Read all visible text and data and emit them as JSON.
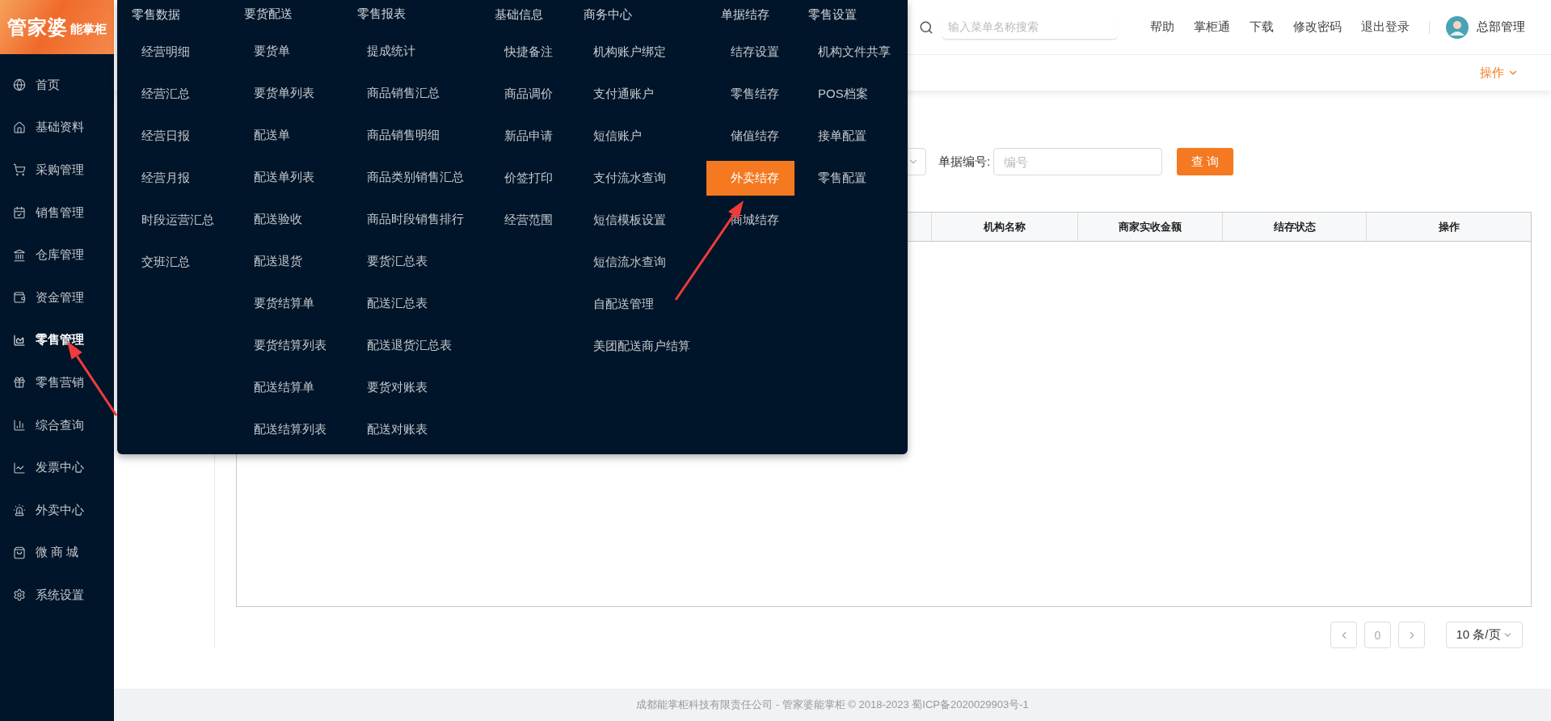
{
  "logo": {
    "main": "管家婆",
    "sub": "能掌柜"
  },
  "sidebar": {
    "items": [
      {
        "label": "首页",
        "selected": false
      },
      {
        "label": "基础资料",
        "selected": false
      },
      {
        "label": "采购管理",
        "selected": false
      },
      {
        "label": "销售管理",
        "selected": false
      },
      {
        "label": "仓库管理",
        "selected": false
      },
      {
        "label": "资金管理",
        "selected": false
      },
      {
        "label": "零售管理",
        "selected": true
      },
      {
        "label": "零售营销",
        "selected": false
      },
      {
        "label": "综合查询",
        "selected": false
      },
      {
        "label": "发票中心",
        "selected": false
      },
      {
        "label": "外卖中心",
        "selected": false
      },
      {
        "label": "微 商 城",
        "selected": false
      },
      {
        "label": "系统设置",
        "selected": false
      }
    ]
  },
  "header": {
    "search": {
      "placeholder": "输入菜单名称搜索"
    },
    "links": [
      "帮助",
      "掌柜通",
      "下载",
      "修改密码",
      "退出登录"
    ],
    "user": "总部管理"
  },
  "tab_bar": {
    "actions": "操作"
  },
  "filter": {
    "label": "单据编号:",
    "placeholder": "编号",
    "button": "查 询"
  },
  "table": {
    "columns": [
      "机构名称",
      "商家实收金额",
      "结存状态",
      "操作"
    ]
  },
  "pagination": {
    "page": "0",
    "page_size": "10 条/页"
  },
  "footer": "成都能掌柜科技有限责任公司 - 管家婆能掌柜 © 2018-2023 蜀ICP备2020029903号-1",
  "mega_menu": {
    "columns": [
      {
        "title": "零售数据",
        "items": [
          {
            "label": "经营明细",
            "selected": false
          },
          {
            "label": "经营汇总",
            "selected": false
          },
          {
            "label": "经营日报",
            "selected": false
          },
          {
            "label": "经营月报",
            "selected": false
          },
          {
            "label": "时段运营汇总",
            "selected": false
          },
          {
            "label": "交班汇总",
            "selected": false
          }
        ]
      },
      {
        "title": "要货配送",
        "items": [
          {
            "label": "要货单",
            "selected": false
          },
          {
            "label": "要货单列表",
            "selected": false
          },
          {
            "label": "配送单",
            "selected": false
          },
          {
            "label": "配送单列表",
            "selected": false
          },
          {
            "label": "配送验收",
            "selected": false
          },
          {
            "label": "配送退货",
            "selected": false
          },
          {
            "label": "要货结算单",
            "selected": false
          },
          {
            "label": "要货结算列表",
            "selected": false
          },
          {
            "label": "配送结算单",
            "selected": false
          },
          {
            "label": "配送结算列表",
            "selected": false
          }
        ]
      },
      {
        "title": "零售报表",
        "items": [
          {
            "label": "提成统计",
            "selected": false
          },
          {
            "label": "商品销售汇总",
            "selected": false
          },
          {
            "label": "商品销售明细",
            "selected": false
          },
          {
            "label": "商品类别销售汇总",
            "selected": false
          },
          {
            "label": "商品时段销售排行",
            "selected": false
          },
          {
            "label": "要货汇总表",
            "selected": false
          },
          {
            "label": "配送汇总表",
            "selected": false
          },
          {
            "label": "配送退货汇总表",
            "selected": false
          },
          {
            "label": "要货对账表",
            "selected": false
          },
          {
            "label": "配送对账表",
            "selected": false
          }
        ]
      },
      {
        "title": "基础信息",
        "items": [
          {
            "label": "快捷备注",
            "selected": false
          },
          {
            "label": "商品调价",
            "selected": false
          },
          {
            "label": "新品申请",
            "selected": false
          },
          {
            "label": "价签打印",
            "selected": false
          },
          {
            "label": "经营范围",
            "selected": false
          }
        ]
      },
      {
        "title": "商务中心",
        "items": [
          {
            "label": "机构账户绑定",
            "selected": false
          },
          {
            "label": "支付通账户",
            "selected": false
          },
          {
            "label": "短信账户",
            "selected": false
          },
          {
            "label": "支付流水查询",
            "selected": false
          },
          {
            "label": "短信模板设置",
            "selected": false
          },
          {
            "label": "短信流水查询",
            "selected": false
          },
          {
            "label": "自配送管理",
            "selected": false
          },
          {
            "label": "美团配送商户结算",
            "selected": false
          }
        ]
      },
      {
        "title": "单据结存",
        "items": [
          {
            "label": "结存设置",
            "selected": false
          },
          {
            "label": "零售结存",
            "selected": false
          },
          {
            "label": "储值结存",
            "selected": false
          },
          {
            "label": "外卖结存",
            "selected": true
          },
          {
            "label": "商城结存",
            "selected": false
          }
        ]
      },
      {
        "title": "零售设置",
        "items": [
          {
            "label": "机构文件共享",
            "selected": false
          },
          {
            "label": "POS档案",
            "selected": false
          },
          {
            "label": "接单配置",
            "selected": false
          },
          {
            "label": "零售配置",
            "selected": false
          }
        ]
      }
    ]
  }
}
